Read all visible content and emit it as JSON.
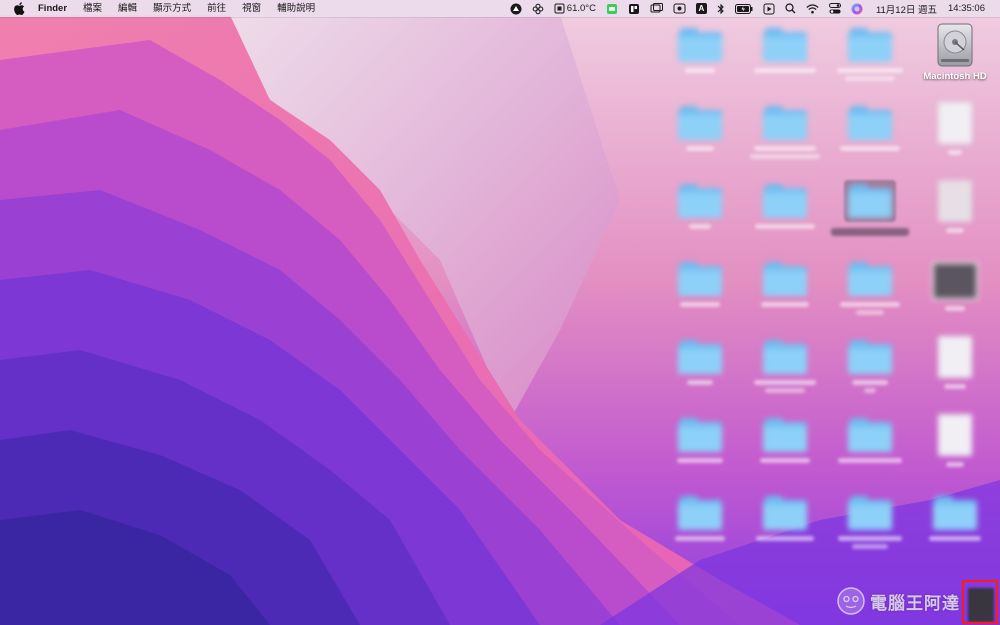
{
  "menubar": {
    "app_name": "Finder",
    "menus": [
      "檔案",
      "編輯",
      "顯示方式",
      "前往",
      "視窗",
      "輔助說明"
    ],
    "temperature": "61.0°C",
    "input_method": "A",
    "date": "11月12日 週五",
    "time": "14:35:06",
    "status_icons": [
      "istat-icon",
      "flower-icon",
      "cpu-temp-icon",
      "green-status-icon",
      "app-icon",
      "screens-icon",
      "eye-icon",
      "input-method-icon",
      "bluetooth-icon",
      "battery-icon",
      "play-icon",
      "spotlight-icon",
      "wifi-icon",
      "control-center-icon",
      "siri-icon"
    ]
  },
  "desktop": {
    "drive": {
      "label": "Macintosh HD",
      "icon": "hard-drive-icon"
    },
    "blurred_items": "desktop files and folders (blurred)"
  },
  "watermark": {
    "text": "電腦王阿達"
  },
  "colors": {
    "highlight": "#ff1a1a",
    "folder": "#74c0f2"
  }
}
